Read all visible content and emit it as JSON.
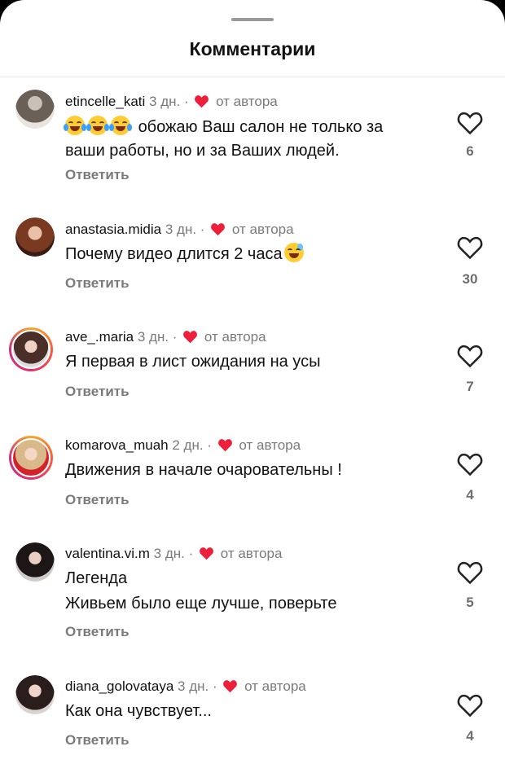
{
  "sheet": {
    "title": "Комментарии"
  },
  "labels": {
    "reply": "Ответить",
    "author_like": "от автора"
  },
  "colors": {
    "heart": "#ed1f3a",
    "accent_ring": "#e1306c",
    "muted": "#7a7a7a"
  },
  "comments": [
    {
      "username": "etincelle_kati",
      "time": "3 дн.",
      "line1_emoji": "😂😂😂",
      "line1": "обожаю Ваш салон не только за",
      "line2": "ваши работы, но и за Ваших людей.",
      "likes": "6",
      "avatar_icon": "avatar-photo-person"
    },
    {
      "username": "anastasia.midia",
      "time": "3 дн.",
      "line1": "Почему видео длится 2 часа",
      "line1_trailing_emoji": "😅",
      "likes": "30",
      "avatar_icon": "avatar-photo-person"
    },
    {
      "username": "ave_.maria",
      "time": "3 дн.",
      "line1": "Я первая в лист ожидания на усы",
      "likes": "7",
      "avatar_icon": "avatar-photo-person-story-ring"
    },
    {
      "username": "komarova_muah",
      "time": "2 дн.",
      "line1": "Движения в начале очаровательны !",
      "likes": "4",
      "avatar_icon": "avatar-photo-person-story-ring"
    },
    {
      "username": "valentina.vi.m",
      "time": "3 дн.",
      "line1": "Легенда",
      "line2": "Живьем было еще лучше, поверьте",
      "likes": "5",
      "avatar_icon": "avatar-photo-person"
    },
    {
      "username": "diana_golovataya",
      "time": "3 дн.",
      "line1": "Как она чувствует...",
      "likes": "4",
      "avatar_icon": "avatar-photo-person"
    }
  ]
}
